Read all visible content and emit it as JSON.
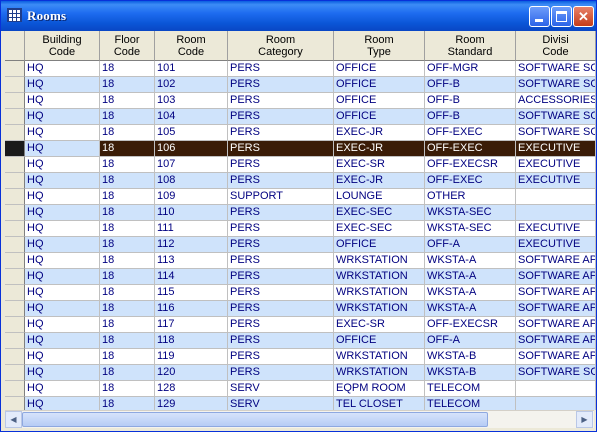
{
  "window": {
    "title": "Rooms",
    "icon": "table-icon"
  },
  "columns": [
    "Building\nCode",
    "Floor\nCode",
    "Room\nCode",
    "Room\nCategory",
    "Room\nType",
    "Room\nStandard",
    "Divisi\nCode"
  ],
  "rows": [
    [
      "HQ",
      "18",
      "101",
      "PERS",
      "OFFICE",
      "OFF-MGR",
      "SOFTWARE SOL"
    ],
    [
      "HQ",
      "18",
      "102",
      "PERS",
      "OFFICE",
      "OFF-B",
      "SOFTWARE SOL"
    ],
    [
      "HQ",
      "18",
      "103",
      "PERS",
      "OFFICE",
      "OFF-B",
      "ACCESSORIES"
    ],
    [
      "HQ",
      "18",
      "104",
      "PERS",
      "OFFICE",
      "OFF-B",
      "SOFTWARE SOL"
    ],
    [
      "HQ",
      "18",
      "105",
      "PERS",
      "EXEC-JR",
      "OFF-EXEC",
      "SOFTWARE SOL"
    ],
    [
      "HQ",
      "18",
      "106",
      "PERS",
      "EXEC-JR",
      "OFF-EXEC",
      "EXECUTIVE"
    ],
    [
      "HQ",
      "18",
      "107",
      "PERS",
      "EXEC-SR",
      "OFF-EXECSR",
      "EXECUTIVE"
    ],
    [
      "HQ",
      "18",
      "108",
      "PERS",
      "EXEC-JR",
      "OFF-EXEC",
      "EXECUTIVE"
    ],
    [
      "HQ",
      "18",
      "109",
      "SUPPORT",
      "LOUNGE",
      "OTHER",
      ""
    ],
    [
      "HQ",
      "18",
      "110",
      "PERS",
      "EXEC-SEC",
      "WKSTA-SEC",
      ""
    ],
    [
      "HQ",
      "18",
      "111",
      "PERS",
      "EXEC-SEC",
      "WKSTA-SEC",
      "EXECUTIVE"
    ],
    [
      "HQ",
      "18",
      "112",
      "PERS",
      "OFFICE",
      "OFF-A",
      "EXECUTIVE"
    ],
    [
      "HQ",
      "18",
      "113",
      "PERS",
      "WRKSTATION",
      "WKSTA-A",
      "SOFTWARE APP"
    ],
    [
      "HQ",
      "18",
      "114",
      "PERS",
      "WRKSTATION",
      "WKSTA-A",
      "SOFTWARE APP"
    ],
    [
      "HQ",
      "18",
      "115",
      "PERS",
      "WRKSTATION",
      "WKSTA-A",
      "SOFTWARE APP"
    ],
    [
      "HQ",
      "18",
      "116",
      "PERS",
      "WRKSTATION",
      "WKSTA-A",
      "SOFTWARE APP"
    ],
    [
      "HQ",
      "18",
      "117",
      "PERS",
      "EXEC-SR",
      "OFF-EXECSR",
      "SOFTWARE APP"
    ],
    [
      "HQ",
      "18",
      "118",
      "PERS",
      "OFFICE",
      "OFF-A",
      "SOFTWARE APP"
    ],
    [
      "HQ",
      "18",
      "119",
      "PERS",
      "WRKSTATION",
      "WKSTA-B",
      "SOFTWARE APP"
    ],
    [
      "HQ",
      "18",
      "120",
      "PERS",
      "WRKSTATION",
      "WKSTA-B",
      "SOFTWARE SOL"
    ],
    [
      "HQ",
      "18",
      "128",
      "SERV",
      "EQPM ROOM",
      "TELECOM",
      ""
    ],
    [
      "HQ",
      "18",
      "129",
      "SERV",
      "TEL CLOSET",
      "TELECOM",
      ""
    ]
  ],
  "current_row_index": 5,
  "colors": {
    "row_alt": "#cfe3fb",
    "row_current": "#3a1c07",
    "text": "#000080",
    "titlebar": "#0a55d6"
  }
}
